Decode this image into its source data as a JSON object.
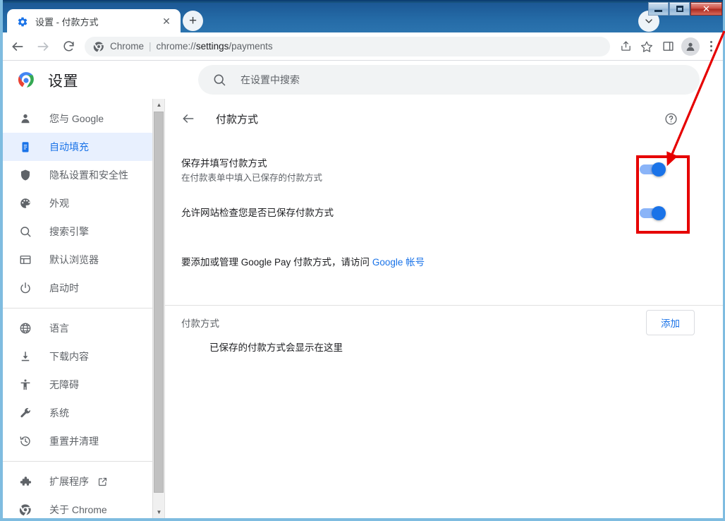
{
  "window": {
    "controls": {
      "minimize": "minimize-button",
      "maximize": "maximize-button",
      "close": "✕"
    }
  },
  "tabstrip": {
    "tabs": [
      {
        "title": "设置 - 付款方式",
        "favicon": "settings-gear-icon",
        "close_label": "✕"
      }
    ],
    "new_tab_label": "+",
    "tab_list_chevron": "chevron-down-icon"
  },
  "toolbar": {
    "back": "back-arrow-icon",
    "forward": "forward-arrow-icon",
    "reload": "reload-icon",
    "omnibox": {
      "site_icon": "chrome-icon",
      "scheme_label": "Chrome",
      "separator": "|",
      "url_prefix": "chrome://",
      "url_highlight": "settings",
      "url_suffix": "/payments"
    },
    "share_icon": "share-icon",
    "bookmark_icon": "star-icon",
    "sidepanel_icon": "side-panel-icon",
    "profile_icon": "profile-avatar-icon",
    "menu_icon": "three-dots-menu-icon"
  },
  "settings_header": {
    "logo": "chrome-logo-icon",
    "title": "设置",
    "search": {
      "icon": "search-icon",
      "placeholder": "在设置中搜索",
      "value": ""
    }
  },
  "sidebar": {
    "groups": [
      {
        "items": [
          {
            "label": "您与 Google",
            "icon": "person-icon",
            "active": false
          },
          {
            "label": "自动填充",
            "icon": "clipboard-icon",
            "active": true
          },
          {
            "label": "隐私设置和安全性",
            "icon": "shield-icon",
            "active": false
          },
          {
            "label": "外观",
            "icon": "palette-icon",
            "active": false
          },
          {
            "label": "搜索引擎",
            "icon": "search-icon",
            "active": false
          },
          {
            "label": "默认浏览器",
            "icon": "browser-window-icon",
            "active": false
          },
          {
            "label": "启动时",
            "icon": "power-icon",
            "active": false
          }
        ]
      },
      {
        "items": [
          {
            "label": "语言",
            "icon": "globe-icon",
            "active": false
          },
          {
            "label": "下载内容",
            "icon": "download-icon",
            "active": false
          },
          {
            "label": "无障碍",
            "icon": "accessibility-icon",
            "active": false
          },
          {
            "label": "系统",
            "icon": "wrench-icon",
            "active": false
          },
          {
            "label": "重置并清理",
            "icon": "history-restore-icon",
            "active": false
          }
        ]
      },
      {
        "items": [
          {
            "label": "扩展程序",
            "icon": "puzzle-icon",
            "active": false,
            "external": true,
            "external_icon": "open-in-new-icon"
          },
          {
            "label": "关于 Chrome",
            "icon": "chrome-icon",
            "active": false
          }
        ]
      }
    ],
    "scrollbar": {
      "up_arrow": "▲",
      "down_arrow": "▼"
    }
  },
  "main": {
    "back_icon": "back-arrow-icon",
    "page_title": "付款方式",
    "help_icon": "help-circle-icon",
    "settings_rows": [
      {
        "title": "保存并填写付款方式",
        "subtitle": "在付款表单中填入已保存的付款方式",
        "toggle_on": true,
        "toggle_color": "#1a73e8"
      },
      {
        "title": "允许网站检查您是否已保存付款方式",
        "subtitle": "",
        "toggle_on": true,
        "toggle_color": "#1a73e8"
      }
    ],
    "google_pay_note": {
      "text_before": "要添加或管理 Google Pay 付款方式，请访问 ",
      "link_text": "Google 帐号"
    },
    "payment_section": {
      "title": "付款方式",
      "add_button": "添加",
      "empty_message": "已保存的付款方式会显示在这里"
    }
  },
  "annotation": {
    "box_color": "#e60000",
    "arrow_color": "#e60000",
    "arrow_label": "pointer-arrow"
  }
}
